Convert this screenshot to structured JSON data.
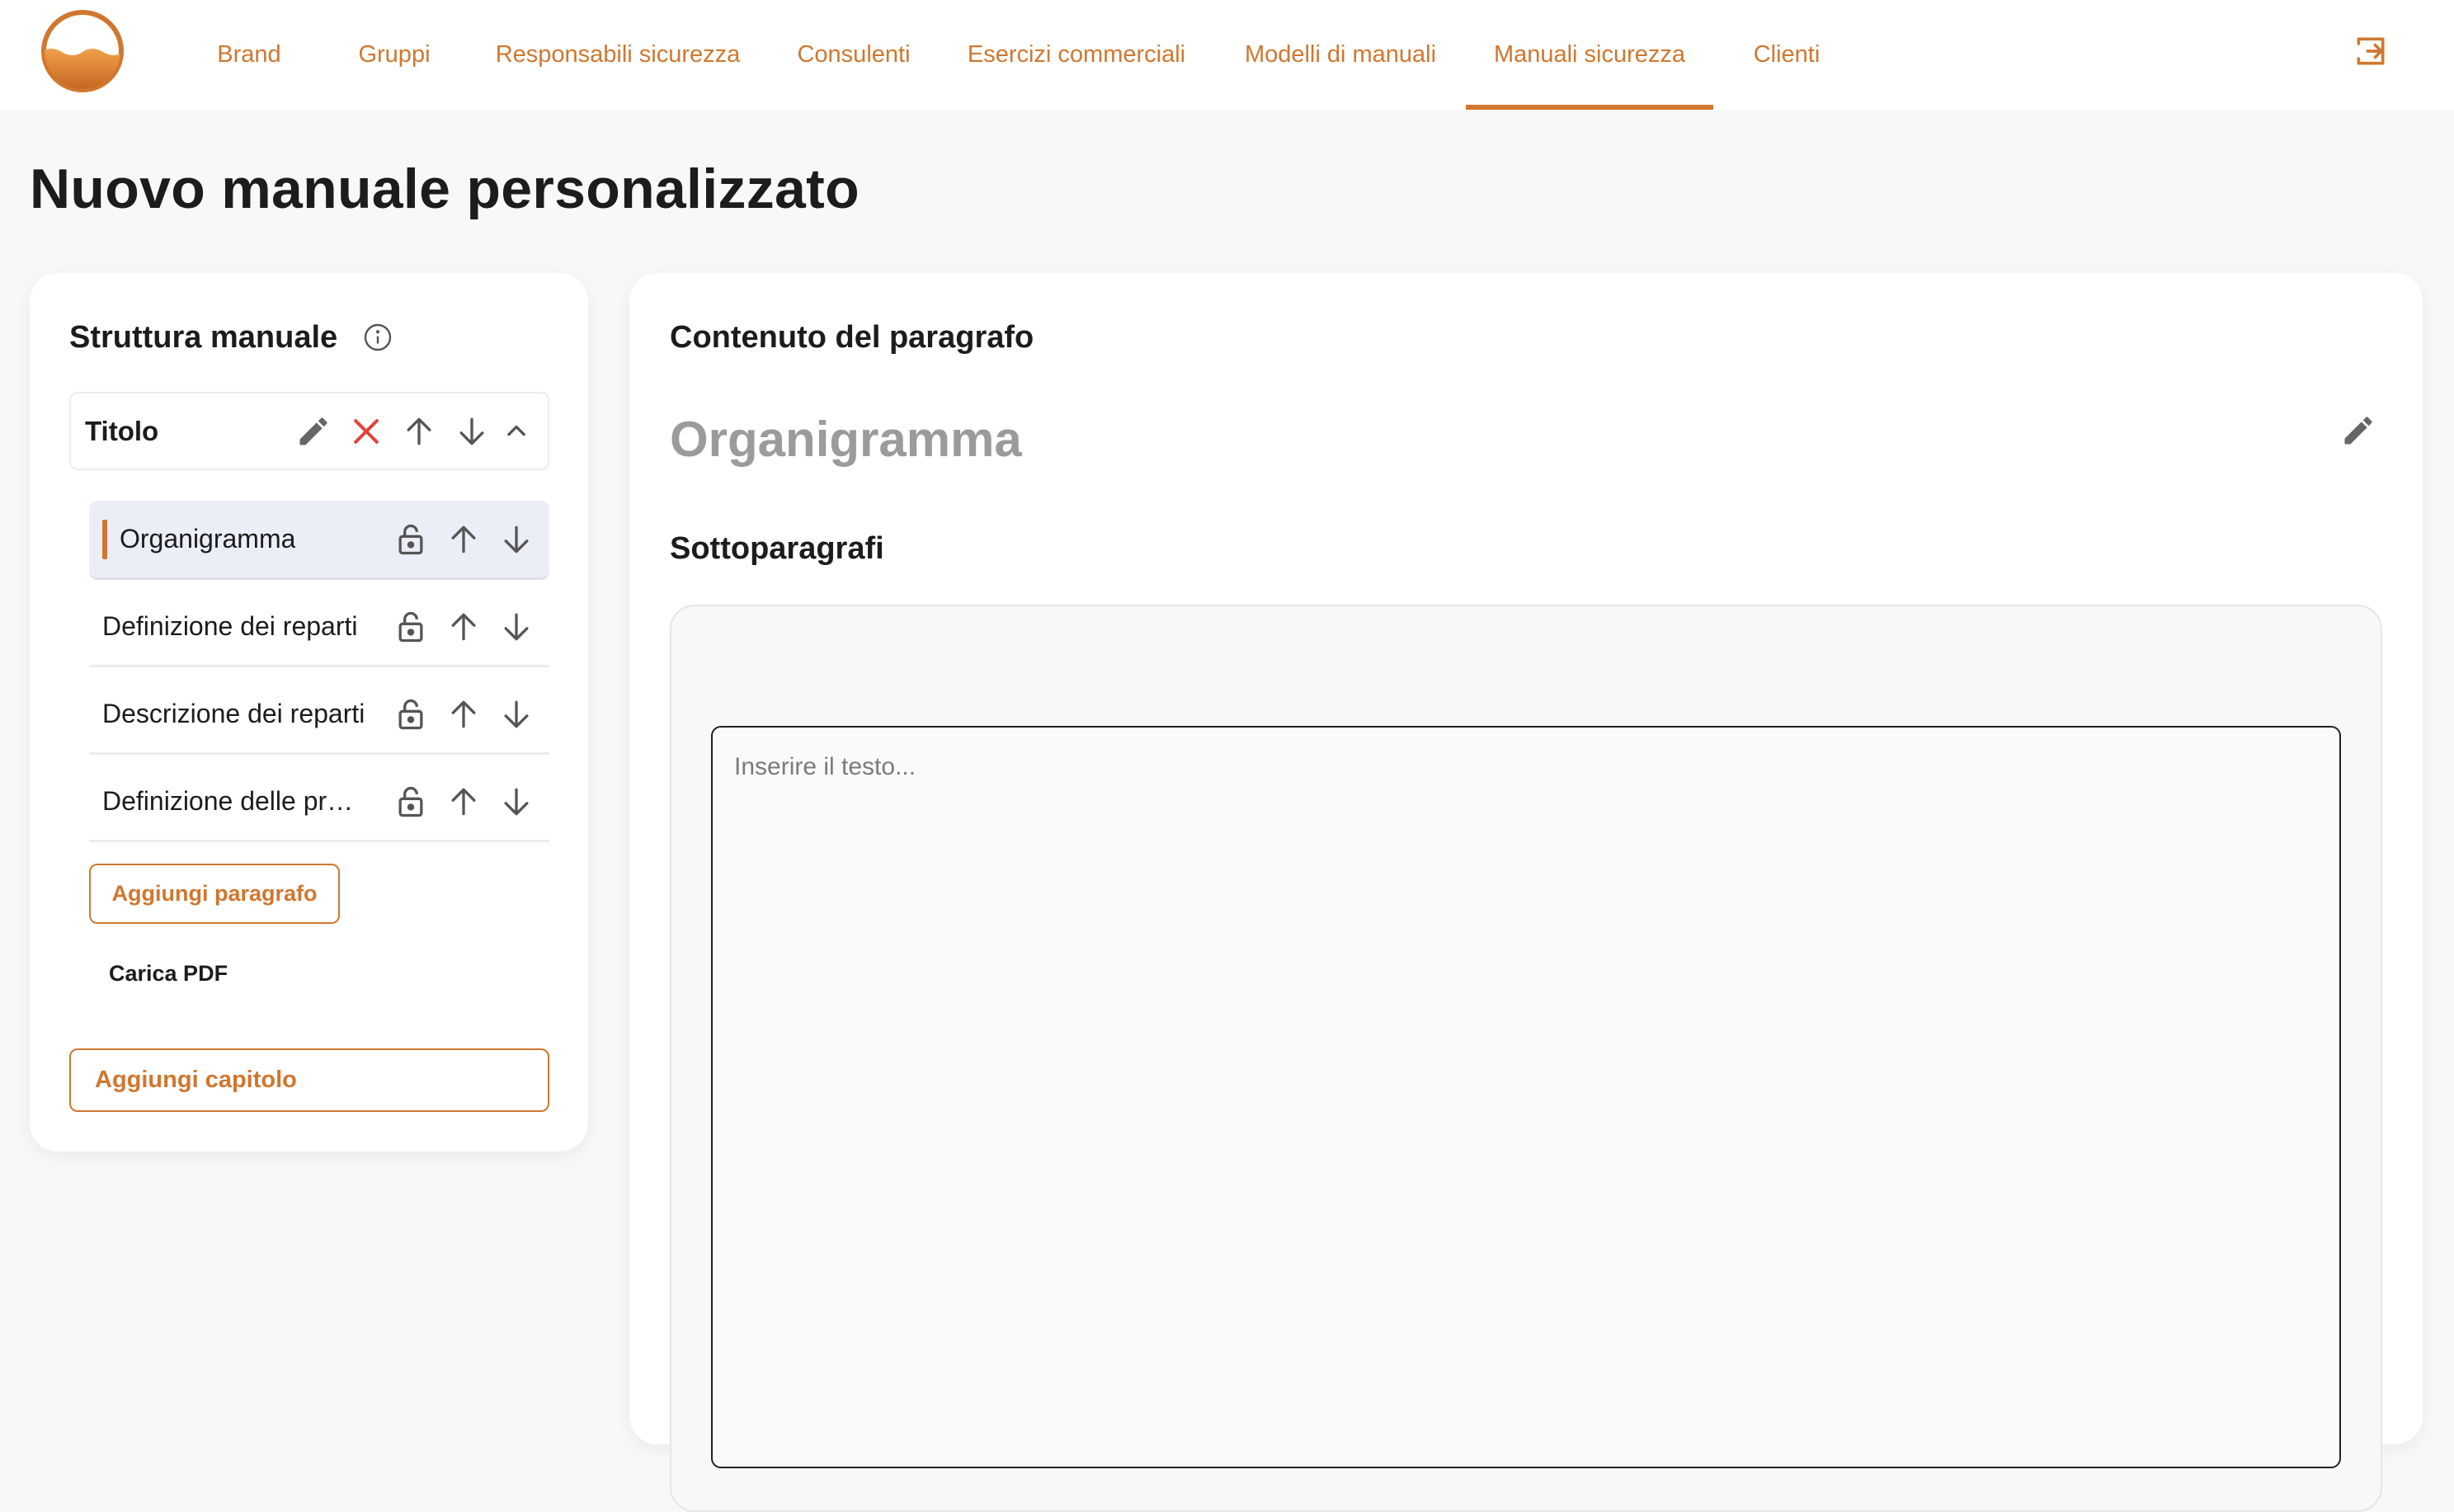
{
  "nav": {
    "items": [
      {
        "label": "Brand"
      },
      {
        "label": "Gruppi"
      },
      {
        "label": "Responsabili sicurezza"
      },
      {
        "label": "Consulenti"
      },
      {
        "label": "Esercizi commerciali"
      },
      {
        "label": "Modelli di manuali"
      },
      {
        "label": "Manuali sicurezza"
      },
      {
        "label": "Clienti"
      }
    ],
    "active": "Manuali sicurezza",
    "logout_icon": "logout-icon"
  },
  "page": {
    "title": "Nuovo manuale personalizzato"
  },
  "structure": {
    "title": "Struttura manuale",
    "chapter": {
      "label": "Titolo"
    },
    "paragraphs": [
      {
        "label": "Organigramma"
      },
      {
        "label": "Definizione dei reparti"
      },
      {
        "label": "Descrizione dei reparti"
      },
      {
        "label": "Definizione delle pr…"
      }
    ],
    "add_paragraph_label": "Aggiungi paragrafo",
    "upload_pdf_label": "Carica PDF",
    "add_chapter_label": "Aggiungi capitolo"
  },
  "content": {
    "title": "Contenuto del paragrafo",
    "paragraph_title": "Organigramma",
    "subparagraphs_title": "Sottoparagrafi",
    "editor_placeholder": "Inserire il testo..."
  },
  "colors": {
    "accent": "#d0772f",
    "delete": "#e0453a",
    "selected_row": "#eceef7"
  }
}
